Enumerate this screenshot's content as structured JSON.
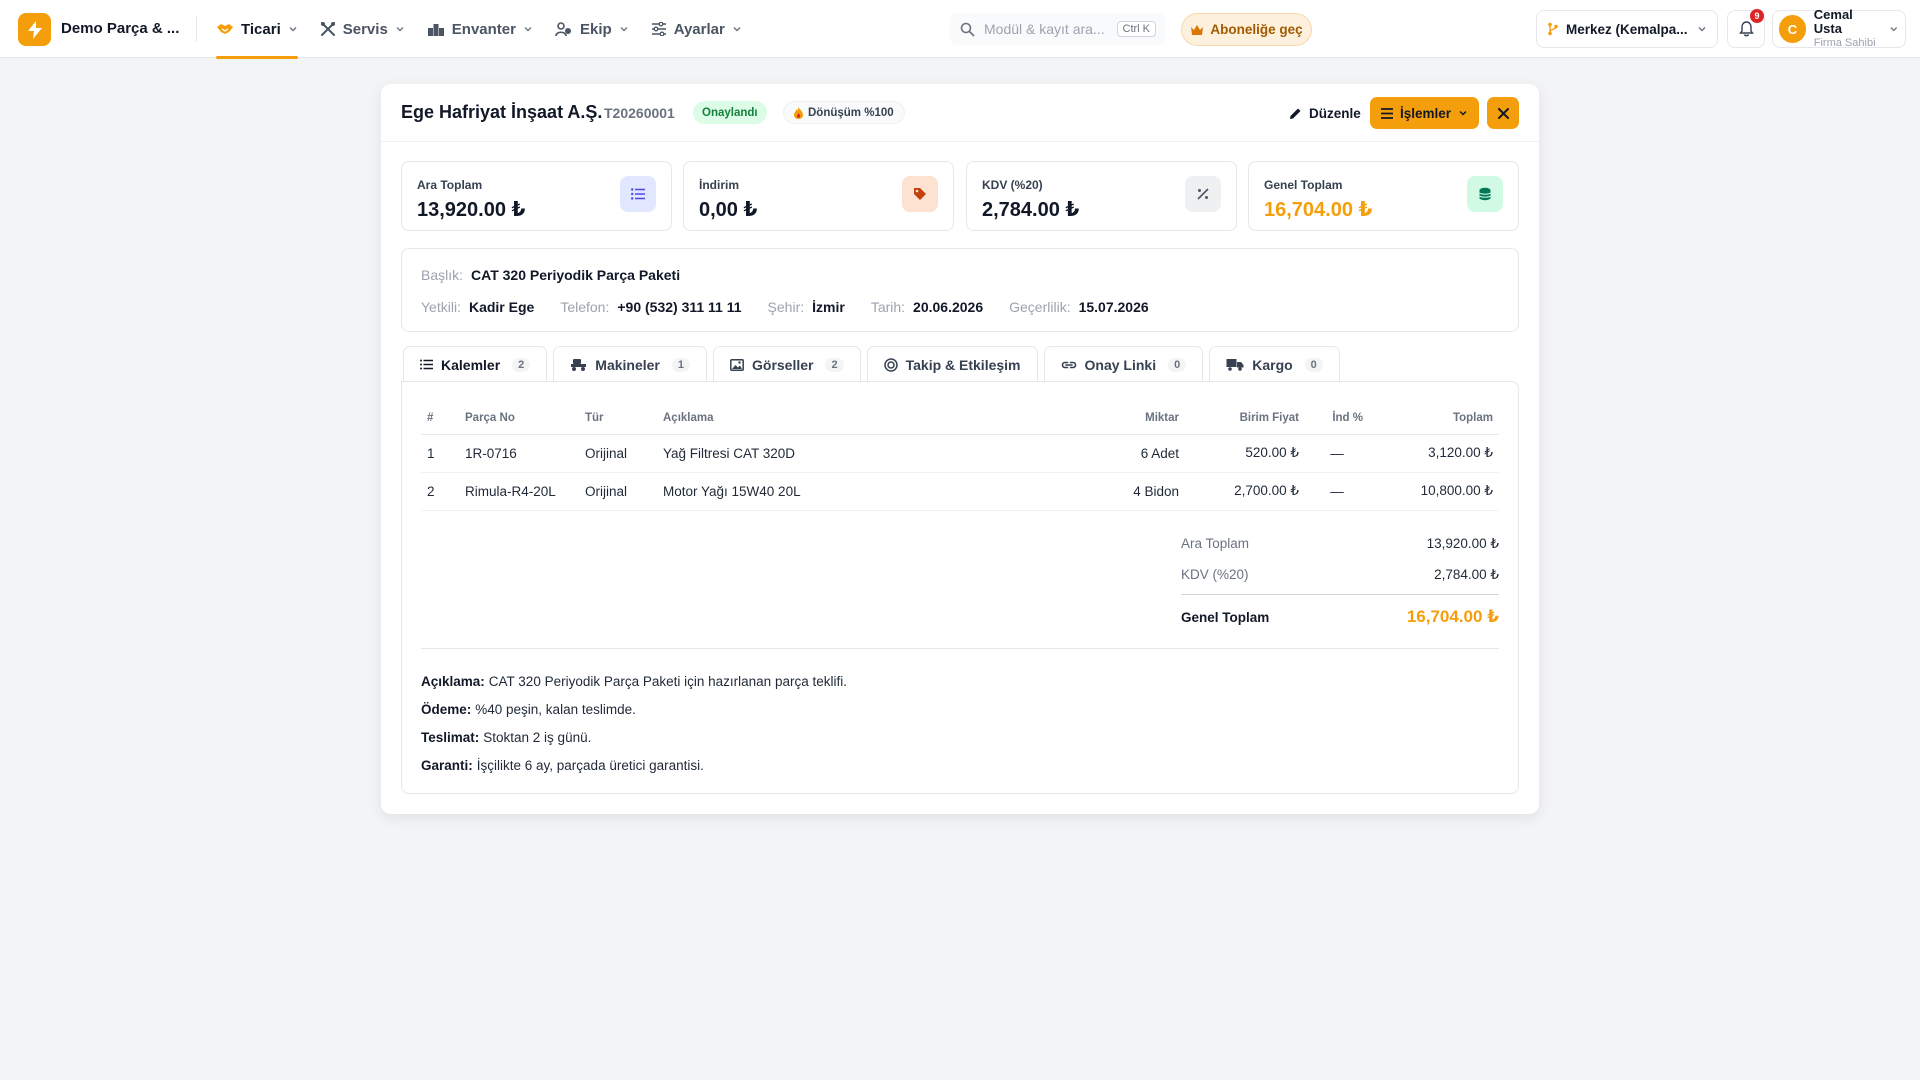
{
  "app": {
    "name": "Demo Parça & ..."
  },
  "nav": [
    {
      "label": "Ticari",
      "icon": "handshake-icon"
    },
    {
      "label": "Servis",
      "icon": "tools-icon"
    },
    {
      "label": "Envanter",
      "icon": "warehouse-icon"
    },
    {
      "label": "Ekip",
      "icon": "users-icon"
    },
    {
      "label": "Ayarlar",
      "icon": "sliders-icon"
    }
  ],
  "search": {
    "placeholder": "Modül & kayıt ara...",
    "shortcut": "Ctrl K"
  },
  "subscribe": {
    "label": "Aboneliğe geç"
  },
  "branch": {
    "label": "Merkez (Kemalpa..."
  },
  "notifications": {
    "count": "9"
  },
  "user": {
    "initial": "C",
    "name": "Cemal Usta",
    "role": "Firma Sahibi"
  },
  "colors": {
    "accent": "#f59e0b",
    "success": "#15803d"
  },
  "quote": {
    "company": "Ege Hafriyat İnşaat A.Ş.",
    "doc_no": "T20260001",
    "status": "Onaylandı",
    "conversion": "Dönüşüm %100",
    "edit_label": "Düzenle",
    "actions_label": "İşlemler"
  },
  "stats": [
    {
      "label": "Ara Toplam",
      "value": "13,920.00 ₺",
      "icon": "list-icon"
    },
    {
      "label": "İndirim",
      "value": "0,00 ₺",
      "icon": "tag-icon"
    },
    {
      "label": "KDV (%20)",
      "value": "2,784.00 ₺",
      "icon": "percent-icon"
    },
    {
      "label": "Genel Toplam",
      "value": "16,704.00 ₺",
      "icon": "coins-icon"
    }
  ],
  "info": {
    "title_label": "Başlık:",
    "title": "CAT 320 Periyodik Parça Paketi",
    "contact_label": "Yetkili:",
    "contact": "Kadir Ege",
    "phone_label": "Telefon:",
    "phone": "+90 (532) 311 11 11",
    "city_label": "Şehir:",
    "city": "İzmir",
    "date_label": "Tarih:",
    "date": "20.06.2026",
    "valid_label": "Geçerlilik:",
    "valid": "15.07.2026"
  },
  "tabs": [
    {
      "label": "Kalemler",
      "count": "2",
      "icon": "list-icon"
    },
    {
      "label": "Makineler",
      "count": "1",
      "icon": "machine-icon"
    },
    {
      "label": "Görseller",
      "count": "2",
      "icon": "image-icon"
    },
    {
      "label": "Takip & Etkileşim",
      "count": "",
      "icon": "target-icon"
    },
    {
      "label": "Onay Linki",
      "count": "0",
      "icon": "link-icon"
    },
    {
      "label": "Kargo",
      "count": "0",
      "icon": "truck-icon"
    }
  ],
  "table": {
    "headers": [
      "#",
      "Parça No",
      "Tür",
      "Açıklama",
      "Miktar",
      "Birim Fiyat",
      "İnd %",
      "Toplam"
    ],
    "rows": [
      [
        "1",
        "1R-0716",
        "Orijinal",
        "Yağ Filtresi CAT 320D",
        "6 Adet",
        "520.00 ₺",
        "—",
        "3,120.00 ₺"
      ],
      [
        "2",
        "Rimula-R4-20L",
        "Orijinal",
        "Motor Yağı 15W40 20L",
        "4 Bidon",
        "2,700.00 ₺",
        "—",
        "10,800.00 ₺"
      ]
    ]
  },
  "totals": {
    "subtotal_label": "Ara Toplam",
    "subtotal": "13,920.00 ₺",
    "vat_label": "KDV (%20)",
    "vat": "2,784.00 ₺",
    "grand_label": "Genel Toplam",
    "grand": "16,704.00 ₺"
  },
  "notes": [
    {
      "label": "Açıklama:",
      "text": "CAT 320 Periyodik Parça Paketi için hazırlanan parça teklifi."
    },
    {
      "label": "Ödeme:",
      "text": "%40 peşin, kalan teslimde."
    },
    {
      "label": "Teslimat:",
      "text": "Stoktan 2 iş günü."
    },
    {
      "label": "Garanti:",
      "text": "İşçilikte 6 ay, parçada üretici garantisi."
    }
  ]
}
